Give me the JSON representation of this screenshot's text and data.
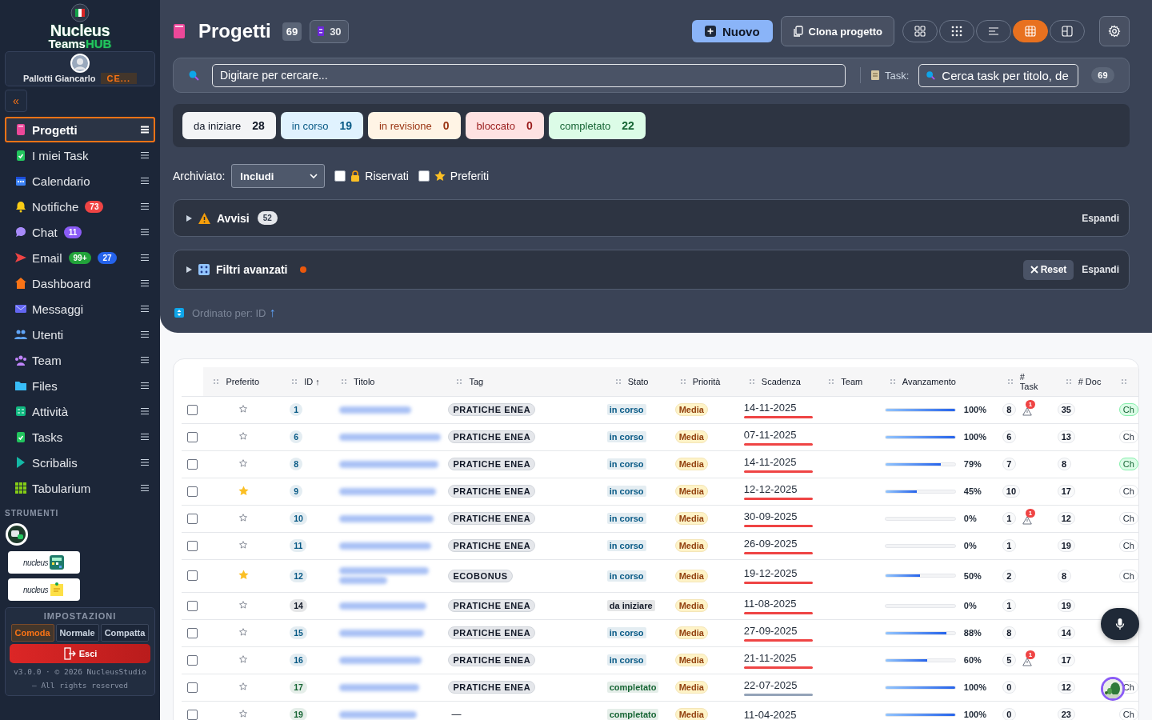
{
  "sidebar": {
    "logo": {
      "line1": "Nucleus",
      "line2": "Teams",
      "line2_accent": "HUB"
    },
    "user": {
      "name": "Pallotti Giancarlo",
      "role": "CE..."
    },
    "collapse": "«",
    "items": [
      {
        "label": "Progetti",
        "selected": true
      },
      {
        "label": "I miei Task",
        "selected": false
      },
      {
        "label": "Calendario",
        "selected": false
      },
      {
        "label": "Notifiche",
        "selected": false,
        "badges": [
          {
            "text": "73",
            "color": "#ef4444"
          }
        ]
      },
      {
        "label": "Chat",
        "selected": false,
        "badges": [
          {
            "text": "11",
            "color": "#8b5cf6"
          }
        ]
      },
      {
        "label": "Email",
        "selected": false,
        "badges": [
          {
            "text": "99+",
            "color": "#22a33a"
          },
          {
            "text": "27",
            "color": "#2563eb"
          }
        ]
      },
      {
        "label": "Dashboard",
        "selected": false
      },
      {
        "label": "Messaggi",
        "selected": false
      },
      {
        "label": "Utenti",
        "selected": false
      },
      {
        "label": "Team",
        "selected": false
      },
      {
        "label": "Files",
        "selected": false
      },
      {
        "label": "Attività",
        "selected": false
      },
      {
        "label": "Tasks",
        "selected": false
      },
      {
        "label": "Scribalis",
        "selected": false
      },
      {
        "label": "Tabularium",
        "selected": false
      }
    ],
    "tools_heading": "STRUMENTI",
    "tools": [
      {
        "text": "nucleus"
      },
      {
        "text": "nucleus"
      }
    ],
    "settings": {
      "heading": "IMPOSTAZIONI",
      "density": [
        {
          "label": "Comoda",
          "selected": true
        },
        {
          "label": "Normale",
          "selected": false
        },
        {
          "label": "Compatta",
          "selected": false
        }
      ],
      "logout": "Esci",
      "footer": "v3.0.0 · © 2026 NucleusStudio – All rights reserved"
    }
  },
  "header": {
    "title": "Progetti",
    "count": "69",
    "archive_count": "30",
    "new_button": "Nuovo",
    "clone_button": "Clona progetto",
    "view_modes": [
      {
        "selected": false
      },
      {
        "selected": false
      },
      {
        "selected": false
      },
      {
        "selected": true
      },
      {
        "selected": false
      }
    ]
  },
  "search": {
    "placeholder": "Digitare per cercare...",
    "task_label": "Task:",
    "task_placeholder": "Cerca task per titolo, de",
    "task_count": "69"
  },
  "status_filters": [
    {
      "label": "da iniziare",
      "count": "28",
      "kind": "todo"
    },
    {
      "label": "in corso",
      "count": "19",
      "kind": "progress"
    },
    {
      "label": "in revisione",
      "count": "0",
      "kind": "review"
    },
    {
      "label": "bloccato",
      "count": "0",
      "kind": "blocked"
    },
    {
      "label": "completato",
      "count": "22",
      "kind": "done"
    }
  ],
  "filters": {
    "archived_label": "Archiviato:",
    "archived_value": "Includi",
    "checks": [
      {
        "label": "Riservati",
        "checked": false,
        "kind": "lock"
      },
      {
        "label": "Preferiti",
        "checked": false,
        "kind": "star"
      }
    ]
  },
  "alerts": {
    "title": "Avvisi",
    "count": "52",
    "expand": "Espandi"
  },
  "advanced": {
    "title": "Filtri avanzati",
    "active": true,
    "reset": "Reset",
    "expand": "Espandi"
  },
  "sort": {
    "text": "Ordinato per: ID",
    "arrow": "↑"
  },
  "table": {
    "columns": [
      "Preferito",
      "ID ↑",
      "Titolo",
      "Tag",
      "Stato",
      "Priorità",
      "Scadenza",
      "Team",
      "Avanzamento",
      "# Task",
      "# Doc"
    ],
    "rows": [
      {
        "selected": false,
        "favorite": false,
        "id": "1",
        "title_hidden": true,
        "tag": "PRATICHE ENEA",
        "status": {
          "label": "in corso",
          "color": "#075985"
        },
        "priority": "Media",
        "due": "14-11-2025",
        "overdue": true,
        "level": 1,
        "percent": "100%",
        "tasks": "8",
        "alert": "1",
        "docs": "35",
        "column_12": "Ch",
        "flag": true
      },
      {
        "selected": false,
        "favorite": false,
        "id": "6",
        "title_hidden": true,
        "tag": "PRATICHE ENEA",
        "status": {
          "label": "in corso",
          "color": "#075985"
        },
        "priority": "Media",
        "due": "07-11-2025",
        "overdue": true,
        "level": 1,
        "percent": "100%",
        "tasks": "6",
        "docs": "13",
        "column_12": "Ch",
        "flag": false
      },
      {
        "selected": false,
        "favorite": false,
        "id": "8",
        "title_hidden": true,
        "tag": "PRATICHE ENEA",
        "status": {
          "label": "in corso",
          "color": "#075985"
        },
        "priority": "Media",
        "due": "14-11-2025",
        "overdue": true,
        "level": 0.79,
        "percent": "79%",
        "tasks": "7",
        "docs": "8",
        "column_12": "Ch",
        "flag": true
      },
      {
        "selected": false,
        "favorite": true,
        "id": "9",
        "title_hidden": true,
        "tag": "PRATICHE ENEA",
        "status": {
          "label": "in corso",
          "color": "#075985"
        },
        "priority": "Media",
        "due": "12-12-2025",
        "overdue": true,
        "level": 0.45,
        "percent": "45%",
        "tasks": "10",
        "docs": "17",
        "column_12": "Ch",
        "flag": false
      },
      {
        "selected": false,
        "favorite": false,
        "id": "10",
        "title_hidden": true,
        "tag": "PRATICHE ENEA",
        "status": {
          "label": "in corso",
          "color": "#075985"
        },
        "priority": "Media",
        "due": "30-09-2025",
        "overdue": true,
        "level": 0,
        "percent": "0%",
        "tasks": "1",
        "alert": "1",
        "docs": "12",
        "column_12": "Ch",
        "flag": false
      },
      {
        "selected": false,
        "favorite": false,
        "id": "11",
        "title_hidden": true,
        "tag": "PRATICHE ENEA",
        "status": {
          "label": "in corso",
          "color": "#075985"
        },
        "priority": "Media",
        "due": "26-09-2025",
        "overdue": true,
        "level": 0,
        "percent": "0%",
        "tasks": "1",
        "docs": "19",
        "column_12": "Ch",
        "flag": false
      },
      {
        "selected": false,
        "favorite": true,
        "id": "12",
        "title_hidden": true,
        "tag": "ECOBONUS",
        "status": {
          "label": "in corso",
          "color": "#075985"
        },
        "priority": "Media",
        "due": "19-12-2025",
        "overdue": true,
        "level": 0.5,
        "percent": "50%",
        "tasks": "2",
        "docs": "8",
        "column_12": "Ch",
        "flag": false
      },
      {
        "selected": false,
        "favorite": false,
        "id": "14",
        "title_hidden": true,
        "tag": "PRATICHE ENEA",
        "status": {
          "label": "da iniziare",
          "color": "#111827"
        },
        "priority": "Media",
        "due": "11-08-2025",
        "overdue": true,
        "level": 0,
        "percent": "0%",
        "tasks": "1",
        "docs": "19"
      },
      {
        "selected": false,
        "favorite": false,
        "id": "15",
        "title_hidden": true,
        "tag": "PRATICHE ENEA",
        "status": {
          "label": "in corso",
          "color": "#075985"
        },
        "priority": "Media",
        "due": "27-09-2025",
        "overdue": true,
        "level": 0.88,
        "percent": "88%",
        "tasks": "8",
        "docs": "14"
      },
      {
        "selected": false,
        "favorite": false,
        "id": "16",
        "title_hidden": true,
        "tag": "PRATICHE ENEA",
        "status": {
          "label": "in corso",
          "color": "#075985"
        },
        "priority": "Media",
        "due": "21-11-2025",
        "overdue": true,
        "level": 0.6,
        "percent": "60%",
        "tasks": "5",
        "alert": "1",
        "docs": "17"
      },
      {
        "selected": false,
        "favorite": false,
        "id": "17",
        "title_hidden": true,
        "tag": "PRATICHE ENEA",
        "status": {
          "label": "completato",
          "color": "#166534"
        },
        "priority": "Media",
        "due": "22-07-2025",
        "overdue": false,
        "level": 1,
        "percent": "100%",
        "tasks": "0",
        "docs": "12",
        "column_12": "Ch",
        "flag": false
      },
      {
        "selected": false,
        "favorite": false,
        "id": "19",
        "title_hidden": true,
        "tag": "—",
        "tag_empty": true,
        "status": {
          "label": "completato",
          "color": "#166534"
        },
        "priority": "Media",
        "due": "11-04-2025",
        "level": 1,
        "percent": "100%",
        "tasks": "0",
        "docs": "23",
        "column_12": "Ch",
        "flag": false
      }
    ]
  }
}
